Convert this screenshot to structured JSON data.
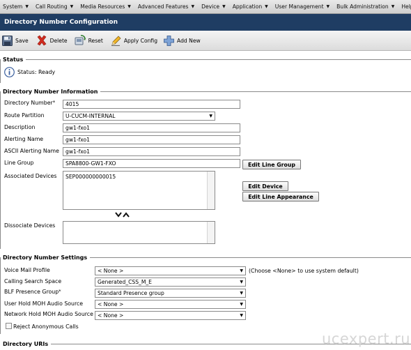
{
  "menu": [
    {
      "label": "System"
    },
    {
      "label": "Call Routing"
    },
    {
      "label": "Media Resources"
    },
    {
      "label": "Advanced Features"
    },
    {
      "label": "Device"
    },
    {
      "label": "Application"
    },
    {
      "label": "User Management"
    },
    {
      "label": "Bulk Administration"
    },
    {
      "label": "Help"
    }
  ],
  "page_title": "Directory Number Configuration",
  "toolbar": {
    "save": "Save",
    "delete": "Delete",
    "reset": "Reset",
    "apply_config": "Apply Config",
    "add_new": "Add New"
  },
  "status": {
    "section_title": "Status",
    "text": "Status: Ready"
  },
  "dn_info": {
    "section_title": "Directory Number Information",
    "directory_number": {
      "label": "Directory Number",
      "required": "*",
      "value": "4015"
    },
    "route_partition": {
      "label": "Route Partition",
      "value": "U-CUCM-INTERNAL"
    },
    "description": {
      "label": "Description",
      "value": "gw1-fxo1"
    },
    "alerting_name": {
      "label": "Alerting Name",
      "value": "gw1-fxo1"
    },
    "ascii_alerting_name": {
      "label": "ASCII Alerting Name",
      "value": "gw1-fxo1"
    },
    "line_group": {
      "label": "Line Group",
      "value": "SPA8800-GW1-FXO"
    },
    "associated_devices": {
      "label": "Associated Devices",
      "items": [
        "SEP000000000015"
      ]
    },
    "dissociate_devices": {
      "label": "Dissociate Devices"
    },
    "buttons": {
      "edit_line_group": "Edit Line Group",
      "edit_device": "Edit Device",
      "edit_line_appearance": "Edit Line Appearance"
    }
  },
  "dn_settings": {
    "section_title": "Directory Number Settings",
    "voice_mail_profile": {
      "label": "Voice Mail Profile",
      "value": "< None >",
      "hint": "(Choose <None> to use system default)"
    },
    "calling_search_space": {
      "label": "Calling Search Space",
      "value": "Generated_CSS_M_E"
    },
    "blf_presence_group": {
      "label": "BLF Presence Group",
      "required": "*",
      "value": "Standard Presence group"
    },
    "user_hold_moh": {
      "label": "User Hold MOH Audio Source",
      "value": "< None >"
    },
    "network_hold_moh": {
      "label": "Network Hold MOH Audio Source",
      "value": "< None >"
    },
    "reject_anonymous": {
      "label": "Reject Anonymous Calls"
    }
  },
  "dn_uris": {
    "section_title": "Directory URIs"
  },
  "watermark": "ucexpert.ru",
  "colors": {
    "title_bar": "#1f3d63",
    "delete_icon": "#d12b1f",
    "info_icon": "#3a5f9e"
  }
}
